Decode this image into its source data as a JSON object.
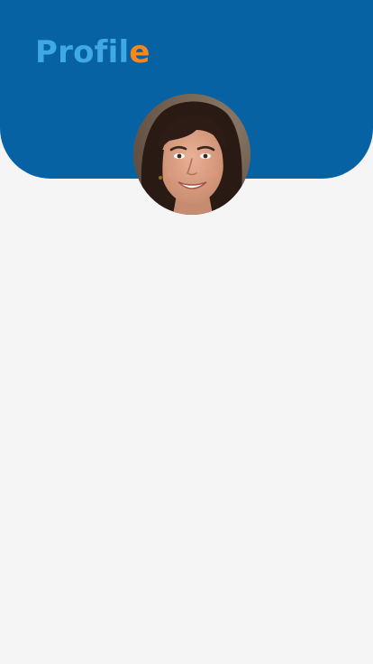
{
  "app": {
    "colors": {
      "header_bg": "#0762a3",
      "page_bg": "#f5f5f5",
      "title_main": "#3fa8e6",
      "title_accent": "#f6871f"
    }
  },
  "header": {
    "title_main": "Profil",
    "title_accent": "e"
  },
  "profile": {
    "avatar": "user-avatar-photo"
  }
}
